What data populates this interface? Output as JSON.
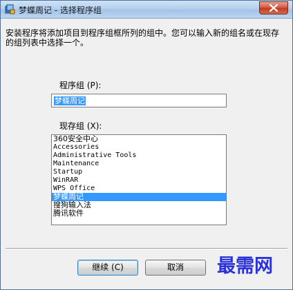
{
  "window": {
    "title": "梦蝶周记 - 选择程序组",
    "close_label": "×"
  },
  "dialog": {
    "description": "安装程序将添加项目到程序组框所列的组中。您可以输入新的组名或在现存的组列表中选择一个。",
    "program_group_label": "程序组 (P):",
    "program_group_value": "梦蝶周记",
    "existing_groups_label": "现存组 (X):",
    "existing_groups": [
      "360安全中心",
      "Accessories",
      "Administrative Tools",
      "Maintenance",
      "Startup",
      "WinRAR",
      "WPS Office",
      "梦蝶周记",
      "搜狗输入法",
      "腾讯软件"
    ],
    "selected_group": "梦蝶周记"
  },
  "buttons": {
    "continue_label": "继续 (C)",
    "cancel_label": "取消"
  },
  "watermark": "最需网",
  "colors": {
    "selection": "#3399ff",
    "watermark": "#2a32d8",
    "close_button": "#c13a1e"
  }
}
